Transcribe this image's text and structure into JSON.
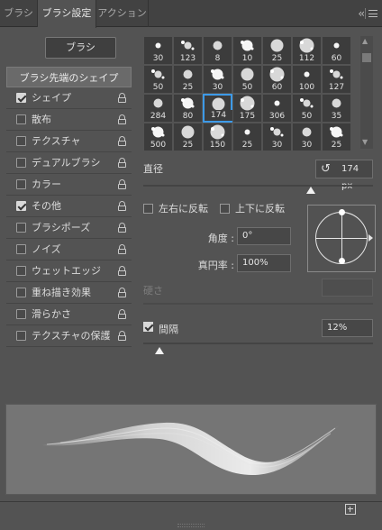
{
  "tabs": [
    {
      "label": "ブラシ"
    },
    {
      "label": "ブラシ設定"
    },
    {
      "label": "アクション"
    }
  ],
  "icons": {
    "collapse": "double-chevron-left-icon",
    "menu": "hamburger-menu-icon",
    "reset": "reset-icon",
    "lock": "lock-icon",
    "new": "new-brush-icon"
  },
  "brush_button": "ブラシ",
  "list_header": "ブラシ先端のシェイプ",
  "options": [
    {
      "label": "シェイプ",
      "checked": true
    },
    {
      "label": "散布",
      "checked": false
    },
    {
      "label": "テクスチャ",
      "checked": false
    },
    {
      "label": "デュアルブラシ",
      "checked": false
    },
    {
      "label": "カラー",
      "checked": false
    },
    {
      "label": "その他",
      "checked": true
    },
    {
      "label": "ブラシポーズ",
      "checked": false
    },
    {
      "label": "ノイズ",
      "checked": false
    },
    {
      "label": "ウェットエッジ",
      "checked": false
    },
    {
      "label": "重ね描き効果",
      "checked": false
    },
    {
      "label": "滑らかさ",
      "checked": false
    },
    {
      "label": "テクスチャの保護",
      "checked": false
    }
  ],
  "brush_sizes": [
    "30",
    "123",
    "8",
    "10",
    "25",
    "112",
    "60",
    "50",
    "25",
    "30",
    "50",
    "60",
    "100",
    "127",
    "284",
    "80",
    "174",
    "175",
    "306",
    "50",
    "35",
    "500",
    "25",
    "150",
    "25",
    "30",
    "30",
    "25"
  ],
  "selected_brush_index": 16,
  "size": {
    "label": "直径",
    "value": "174 px",
    "slider_fraction": 0.73
  },
  "flip_x": {
    "label": "左右に反転"
  },
  "flip_y": {
    "label": "上下に反転"
  },
  "angle": {
    "label": "角度 :",
    "value": "0°"
  },
  "roundness": {
    "label": "真円率 :",
    "value": "100%"
  },
  "hardness": {
    "label": "硬さ"
  },
  "spacing": {
    "label": "間隔",
    "value": "12%",
    "slider_fraction": 0.02
  },
  "colors": {
    "accent": "#3d9ae8",
    "panel": "#535353",
    "tabbar": "#424242"
  }
}
